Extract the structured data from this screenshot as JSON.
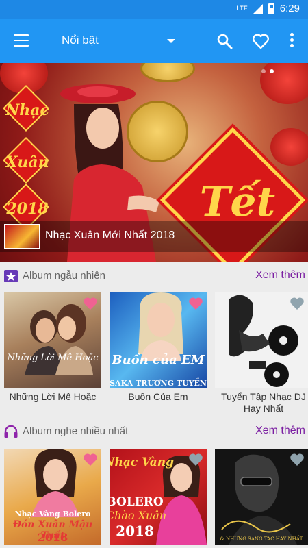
{
  "status_bar": {
    "network": "LTE",
    "time": "6:29"
  },
  "app_bar": {
    "title": "Nổi bật"
  },
  "banner": {
    "caption": "Nhạc Xuân Mới Nhất 2018",
    "art_diamonds": [
      "Nhạc",
      "Xuân",
      "2018"
    ],
    "art_title": "Tết"
  },
  "sections": [
    {
      "title": "Album ngẫu nhiên",
      "see_more": "Xem thêm",
      "icon": "star-badge-icon",
      "albums": [
        {
          "name": "Những Lời Mê Hoặc",
          "cover_text": "Những Lời Mê Hoặc",
          "favorited": true
        },
        {
          "name": "Buồn Của Em",
          "cover_text": "Buồn của EM",
          "cover_subtitle": "SAKA TRƯƠNG TUYỀN",
          "favorited": true
        },
        {
          "name": "Tuyển Tập Nhạc DJ Hay Nhất",
          "cover_text": "",
          "favorited": false
        }
      ]
    },
    {
      "title": "Album nghe nhiều nhất",
      "see_more": "Xem thêm",
      "icon": "headphones-icon",
      "albums": [
        {
          "name": "",
          "cover_small": "Nhạc Vàng Bolero",
          "cover_text": "Đón Xuân Mậu Tuất",
          "cover_year": "2018",
          "favorited": true
        },
        {
          "name": "",
          "cover_small": "Nhạc Vàng",
          "cover_text": "BOLERO",
          "cover_sub": "Chào Xuân",
          "cover_year": "2018",
          "favorited": false
        },
        {
          "name": "",
          "cover_small": "& NHỮNG SÁNG TÁC HAY NHẤT",
          "cover_text": "",
          "favorited": false
        }
      ]
    }
  ],
  "colors": {
    "status_bar": "#1e88e5",
    "app_bar": "#2196f3",
    "accent": "#7b1fa2",
    "favorite_active": "#f06292",
    "favorite_inactive": "#90a4ae"
  }
}
